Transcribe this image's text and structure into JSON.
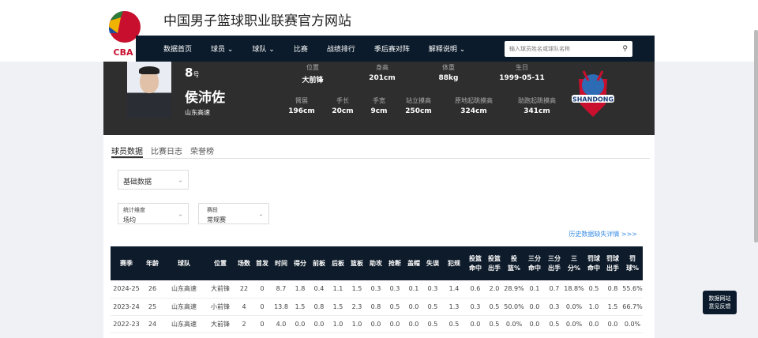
{
  "site": {
    "title": "中国男子篮球职业联赛官方网站",
    "logo_text": "CBA"
  },
  "nav": {
    "items": [
      "数据首页",
      "球员 ⌄",
      "球队 ⌄",
      "比赛",
      "战绩排行",
      "季后赛对阵",
      "解释说明 ⌄"
    ],
    "search_placeholder": "输入球员姓名或球队名称"
  },
  "player": {
    "number": "8",
    "number_suffix": "号",
    "name": "侯沛佐",
    "team": "山东高速",
    "team_logo_text": "SHANDONG",
    "stats_top": [
      {
        "label": "位置",
        "value": "大前锋"
      },
      {
        "label": "身高",
        "value": "201cm"
      },
      {
        "label": "体重",
        "value": "88kg"
      },
      {
        "label": "生日",
        "value": "1999-05-11"
      }
    ],
    "stats_bottom": [
      {
        "label": "臂展",
        "value": "196cm"
      },
      {
        "label": "手长",
        "value": "20cm"
      },
      {
        "label": "手宽",
        "value": "9cm"
      },
      {
        "label": "站立摸高",
        "value": "250cm"
      },
      {
        "label": "原地起跳摸高",
        "value": "324cm"
      },
      {
        "label": "助跑起跳摸高",
        "value": "341cm"
      }
    ]
  },
  "tabs": [
    "球员数据",
    "比赛日志",
    "荣誉榜"
  ],
  "filters": {
    "data_type": "基础数据",
    "dim_label": "统计维度",
    "dim_value": "场均",
    "type_label": "赛段",
    "type_value": "常规赛"
  },
  "history_link": "历史数据缺失详情 >>>",
  "table": {
    "headers": [
      "赛季",
      "年龄",
      "球队",
      "位置",
      "场数",
      "首发",
      "时间",
      "得分",
      "前板",
      "后板",
      "篮板",
      "助攻",
      "抢断",
      "盖帽",
      "失误",
      "犯规",
      "投篮命中",
      "投篮出手",
      "投篮%",
      "三分命中",
      "三分出手",
      "三分%",
      "罚球命中",
      "罚球出手",
      "罚球%"
    ],
    "rows": [
      [
        "2024-25",
        "26",
        "山东高速",
        "大前锋",
        "22",
        "0",
        "8.7",
        "1.8",
        "0.4",
        "1.1",
        "1.5",
        "0.3",
        "0.3",
        "0.1",
        "0.3",
        "1.4",
        "0.6",
        "2.0",
        "28.9%",
        "0.1",
        "0.7",
        "18.8%",
        "0.5",
        "0.8",
        "55.6%"
      ],
      [
        "2023-24",
        "25",
        "山东高速",
        "小前锋",
        "4",
        "0",
        "13.8",
        "1.5",
        "0.8",
        "1.5",
        "2.3",
        "0.8",
        "0.5",
        "0.0",
        "0.5",
        "1.3",
        "0.3",
        "0.5",
        "50.0%",
        "0.0",
        "0.3",
        "0.0%",
        "1.0",
        "1.5",
        "66.7%"
      ],
      [
        "2022-23",
        "24",
        "山东高速",
        "大前锋",
        "2",
        "0",
        "4.0",
        "0.0",
        "0.0",
        "1.0",
        "1.0",
        "0.0",
        "0.0",
        "0.0",
        "0.5",
        "0.5",
        "0.0",
        "0.5",
        "0.0%",
        "0.0",
        "0.5",
        "0.0%",
        "0.0",
        "0.0",
        "0.0%"
      ]
    ]
  },
  "feedback": {
    "line1": "数据网站",
    "line2": "意见反馈"
  }
}
